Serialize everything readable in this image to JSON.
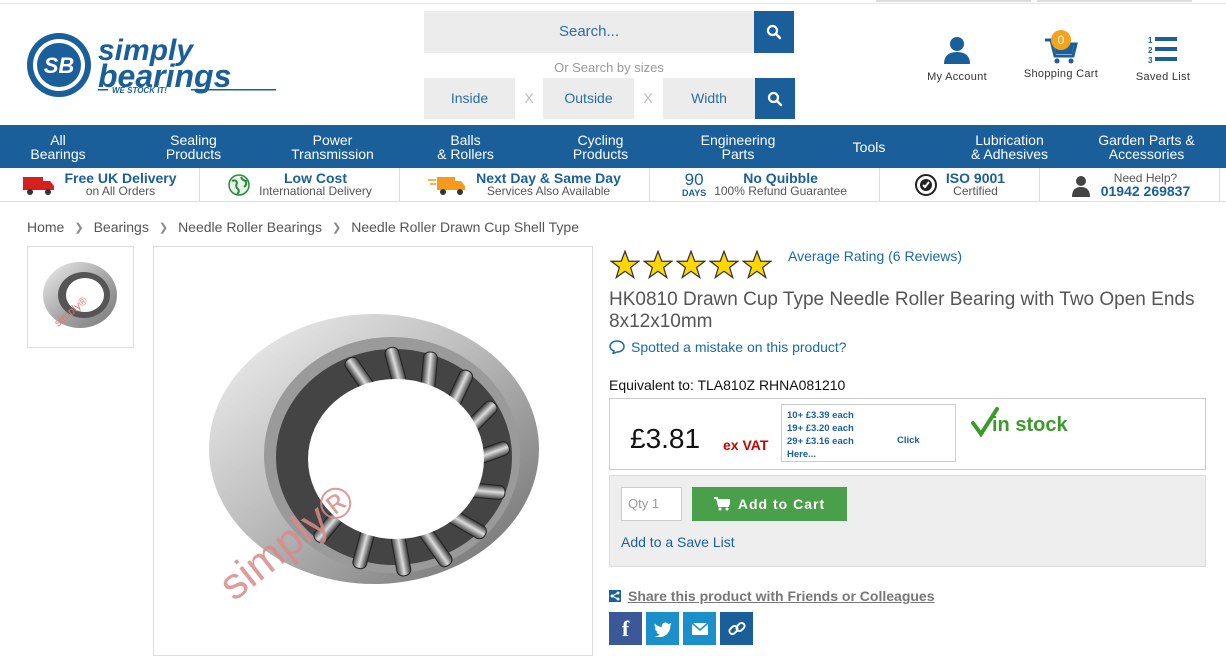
{
  "brand": {
    "line1": "simply",
    "line2": "bearings",
    "tagline": "WE STOCK IT!",
    "mark": "SB"
  },
  "search": {
    "placeholder": "Search...",
    "or_label": "Or Search by sizes",
    "inside": "Inside",
    "outside": "Outside",
    "width": "Width",
    "x": "X"
  },
  "header_icons": {
    "account": "My Account",
    "cart": "Shopping Cart",
    "cart_count": "0",
    "saved": "Saved List"
  },
  "nav": [
    {
      "l1": "All",
      "l2": "Bearings"
    },
    {
      "l1": "Sealing",
      "l2": "Products"
    },
    {
      "l1": "Power",
      "l2": "Transmission"
    },
    {
      "l1": "Balls",
      "l2": "& Rollers"
    },
    {
      "l1": "Cycling",
      "l2": "Products"
    },
    {
      "l1": "Engineering",
      "l2": "Parts"
    },
    {
      "l1": "Tools",
      "l2": ""
    },
    {
      "l1": "Lubrication",
      "l2": "& Adhesives"
    },
    {
      "l1": "Garden Parts &",
      "l2": "Accessories"
    }
  ],
  "usp": [
    {
      "t1": "Free UK Delivery",
      "t2": "on All Orders"
    },
    {
      "t1": "Low Cost",
      "t2": "International Delivery"
    },
    {
      "t1": "Next Day & Same Day",
      "t2": "Services Also Available"
    },
    {
      "t1": "No Quibble",
      "t2": "100% Refund Guarantee",
      "badge_num": "90",
      "badge_txt": "DAYS"
    },
    {
      "t1": "ISO 9001",
      "t2": "Certified"
    },
    {
      "t1": "01942 269837",
      "t2": "Need Help?"
    }
  ],
  "breadcrumb": [
    "Home",
    "Bearings",
    "Needle Roller Bearings",
    "Needle Roller Drawn Cup Shell Type"
  ],
  "watermark": "simply®",
  "product": {
    "rating_value": 5,
    "rating_link": "Average Rating (6 Reviews)",
    "title": "HK0810 Drawn Cup Type Needle Roller Bearing with Two Open Ends 8x12x10mm",
    "mistake": "Spotted a mistake on this product?",
    "equivalent": "Equivalent to: TLA810Z RHNA081210",
    "price": "£3.81",
    "ex_vat": "ex VAT",
    "tiers": [
      "10+ £3.39 each",
      "19+ £3.20 each",
      "29+ £3.16 each"
    ],
    "tier_click": "Click",
    "tier_here": "Here...",
    "stock": "in stock",
    "qty_placeholder": "Qty 1",
    "add_to_cart": "Add to Cart",
    "save_list": "Add to a Save List",
    "share": "Share this product with Friends or Colleagues"
  },
  "colors": {
    "brand_blue": "#1a5f9a",
    "link_blue": "#1a6aa8",
    "green": "#4aa04a",
    "red": "#c00000",
    "cart_badge": "#f5a31a"
  },
  "icons": [
    "search-icon",
    "user-icon",
    "cart-icon",
    "list-icon",
    "truck-icon",
    "globe-icon",
    "fast-truck-icon",
    "iso-icon",
    "support-icon",
    "comment-icon",
    "share-icon",
    "facebook-icon",
    "twitter-icon",
    "email-icon",
    "link-icon"
  ]
}
